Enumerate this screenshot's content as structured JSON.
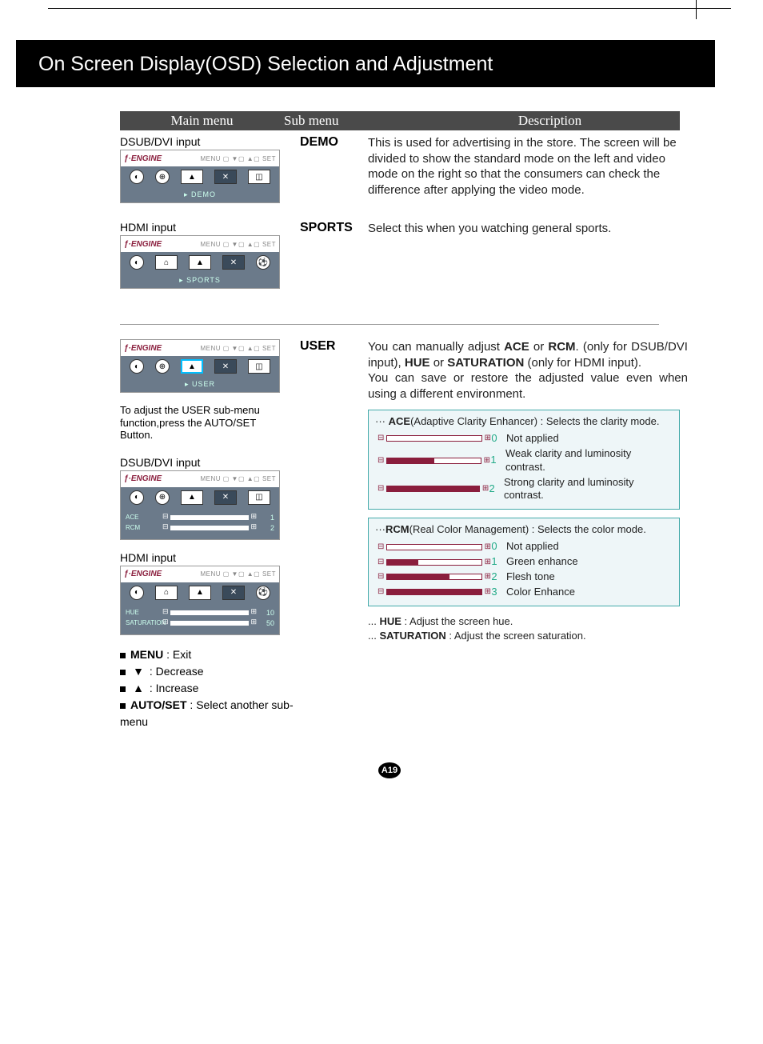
{
  "page_title": "On Screen Display(OSD) Selection and Adjustment",
  "header": {
    "main": "Main menu",
    "sub": "Sub menu",
    "desc": "Description"
  },
  "labels": {
    "dsub_dvi": "DSUB/DVI input",
    "hdmi": "HDMI input",
    "engine": "ƒ·ENGINE",
    "ctrls": "MENU ▢  ▼▢  ▲▢  SET"
  },
  "osd": {
    "demo_footer": "DEMO",
    "sports_footer": "SPORTS",
    "user_footer": "USER",
    "ace_label": "ACE",
    "rcm_label": "RCM",
    "hue_label": "HUE",
    "sat_label": "SATURATION",
    "ace_val": "1",
    "rcm_val": "2",
    "hue_val": "10",
    "sat_val": "50"
  },
  "rows": {
    "demo": {
      "sub": "DEMO",
      "desc": "This is used for advertising in the store. The screen will be divided to show the standard mode on the left and video mode on the right so that the consumers can check the difference after applying the video mode."
    },
    "sports": {
      "sub": "SPORTS",
      "desc": "Select this when you watching general sports."
    },
    "user": {
      "sub": "USER",
      "desc_pre": "You can manually adjust ",
      "desc_mid1": " or ",
      "desc_mid2": ". (only for DSUB/DVI input), ",
      "desc_mid3": " or ",
      "desc_mid4": " (only for HDMI input).",
      "desc2": "You can save or restore the adjusted value even when using a different environment.",
      "ace_b": "ACE",
      "rcm_b": "RCM",
      "hue_b": "HUE",
      "sat_b": "SATURATION"
    }
  },
  "user_note": "To adjust the USER sub-menu function,press the AUTO/SET Button.",
  "ace_box": {
    "title_b": "ACE",
    "title_rest": "(Adaptive Clarity Enhancer) : Selects the clarity mode.",
    "items": [
      {
        "n": "0",
        "fill": 0,
        "t": "Not applied"
      },
      {
        "n": "1",
        "fill": 50,
        "t": "Weak clarity and luminosity contrast."
      },
      {
        "n": "2",
        "fill": 100,
        "t": "Strong clarity and luminosity contrast."
      }
    ]
  },
  "rcm_box": {
    "title_b": "RCM",
    "title_rest": "(Real Color Management) : Selects the color mode.",
    "items": [
      {
        "n": "0",
        "fill": 0,
        "t": "Not applied"
      },
      {
        "n": "1",
        "fill": 33,
        "t": "Green enhance"
      },
      {
        "n": "2",
        "fill": 66,
        "t": "Flesh tone"
      },
      {
        "n": "3",
        "fill": 100,
        "t": "Color Enhance"
      }
    ]
  },
  "below": {
    "hue_b": "HUE",
    "hue_t": " : Adjust the screen hue.",
    "sat_b": "SATURATION",
    "sat_t": " : Adjust the screen saturation."
  },
  "legend": {
    "menu_b": "MENU",
    "menu_t": " : Exit",
    "dec": " : Decrease",
    "inc": " : Increase",
    "auto_b": "AUTO/SET",
    "auto_t": " : Select another sub-menu"
  },
  "page_number": "A19"
}
